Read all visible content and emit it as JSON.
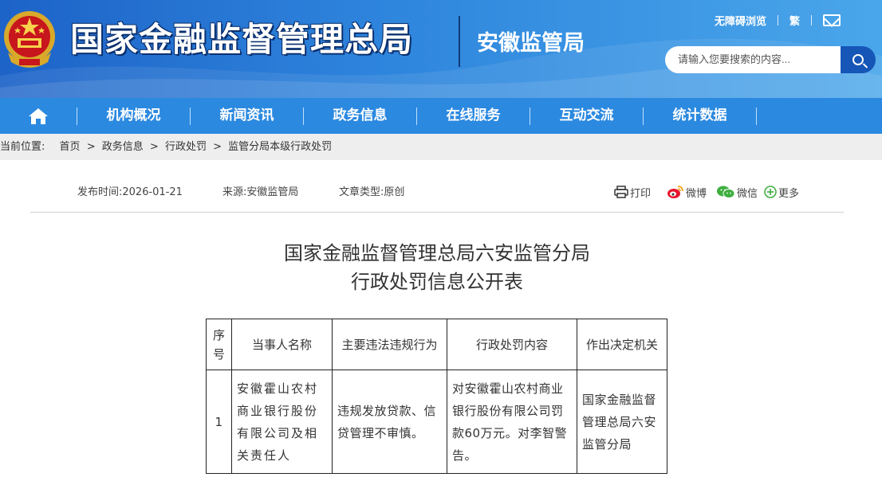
{
  "header": {
    "site_title": "国家金融监督管理总局",
    "sub_title": "安徽监管局",
    "links": {
      "accessibility": "无障碍浏览",
      "traditional": "繁"
    },
    "search_placeholder": "请输入您要搜索的内容..."
  },
  "nav": {
    "items": [
      "机构概况",
      "新闻资讯",
      "政务信息",
      "在线服务",
      "互动交流",
      "统计数据"
    ]
  },
  "breadcrumb": {
    "label": "当前位置:",
    "items": [
      "首页",
      "政务信息",
      "行政处罚",
      "监管分局本级行政处罚"
    ],
    "separator": ">"
  },
  "meta": {
    "publish_label": "发布时间:",
    "publish_date": "2026-01-21",
    "source_label": "来源:",
    "source": "安徽监管局",
    "type_label": "文章类型:",
    "type": "原创"
  },
  "share": {
    "print": "打印",
    "weibo": "微博",
    "wechat": "微信",
    "more": "更多"
  },
  "article": {
    "title_line1": "国家金融监督管理总局六安监管分局",
    "title_line2": "行政处罚信息公开表"
  },
  "table": {
    "headers": [
      "序号",
      "当事人名称",
      "主要违法违规行为",
      "行政处罚内容",
      "作出决定机关"
    ],
    "rows": [
      [
        "1",
        "安徽霍山农村商业银行股份有限公司及相关责任人",
        "违规发放贷款、信贷管理不审慎。",
        "对安徽霍山农村商业银行股份有限公司罚款60万元。对李智警告。",
        "国家金融监督管理总局六安监管分局"
      ]
    ]
  },
  "colors": {
    "header_blue": "#2f86dd",
    "nav_blue": "#2b89e0",
    "search_button": "#1556b7"
  }
}
